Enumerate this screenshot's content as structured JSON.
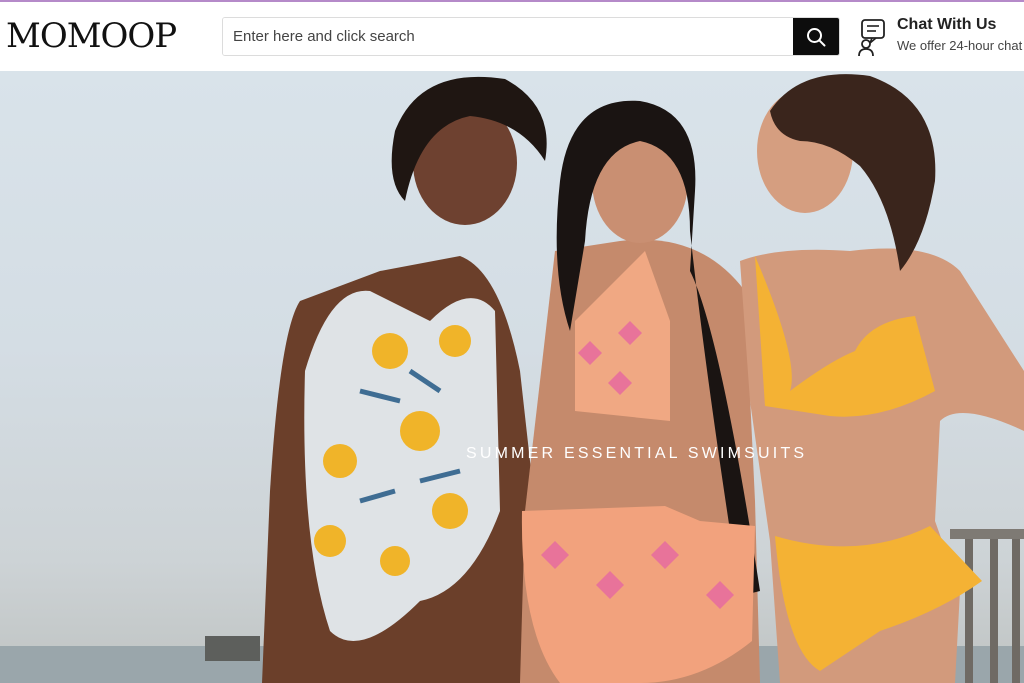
{
  "brand": {
    "logo_text": "MOMOOP"
  },
  "search": {
    "placeholder": "Enter here and click search",
    "button_icon": "search-icon"
  },
  "chat": {
    "title": "Chat With Us",
    "subtitle": "We offer 24-hour chat",
    "icon": "chat-support-icon"
  },
  "hero": {
    "caption": "SUMMER ESSENTIAL SWIMSUITS",
    "image_description": "three smiling women in swimsuits at the beach"
  },
  "colors": {
    "accent_bar": "#b58ac9",
    "search_button": "#0d0d0d"
  }
}
